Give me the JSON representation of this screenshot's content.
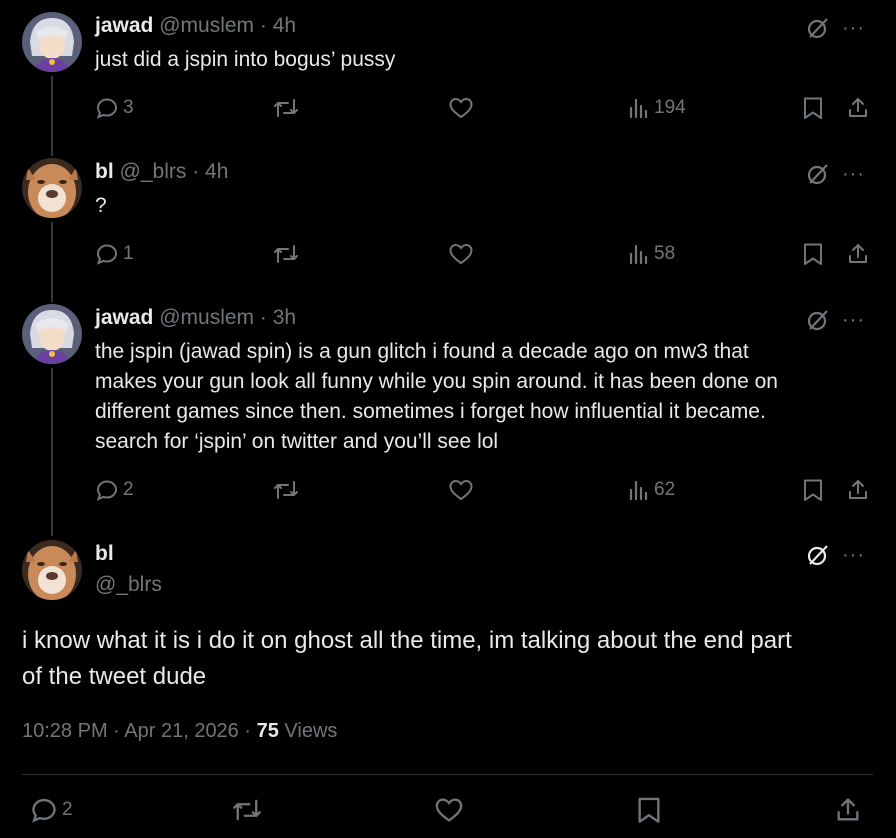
{
  "tweets": [
    {
      "name": "jawad",
      "handle": "@muslem",
      "time": "· 4h",
      "text": "just did a jspin into bogus’ pussy",
      "replies": "3",
      "views": "194"
    },
    {
      "name": "bl",
      "handle": "@_blrs",
      "time": "· 4h",
      "text": "?",
      "replies": "1",
      "views": "58"
    },
    {
      "name": "jawad",
      "handle": "@muslem",
      "time": "· 3h",
      "text_lines": [
        "the jspin (jawad spin) is a gun glitch i found a decade ago on mw3 that",
        "makes your gun look all funny while you spin around. it has been done on",
        "different games since then. sometimes i forget how influential it became.",
        "search for ‘jspin’ on twitter and you’ll see lol"
      ],
      "replies": "2",
      "views": "62"
    }
  ],
  "main_tweet": {
    "name": "bl",
    "handle": "@_blrs",
    "text_lines": [
      "i know what it is i do it on ghost all the time, im talking about the end part",
      "of the tweet dude"
    ],
    "time": "10:28 PM · Apr 21, 2026 ·",
    "views_count": "75",
    "views_label": "Views",
    "replies": "2"
  },
  "colors": {
    "background": "#000000",
    "text": "#e7e9ea",
    "muted": "#71767b",
    "divider": "#2f3336"
  },
  "icons": [
    "grok-icon",
    "more-icon",
    "reply-icon",
    "retweet-icon",
    "like-icon",
    "views-icon",
    "bookmark-icon",
    "share-icon"
  ]
}
